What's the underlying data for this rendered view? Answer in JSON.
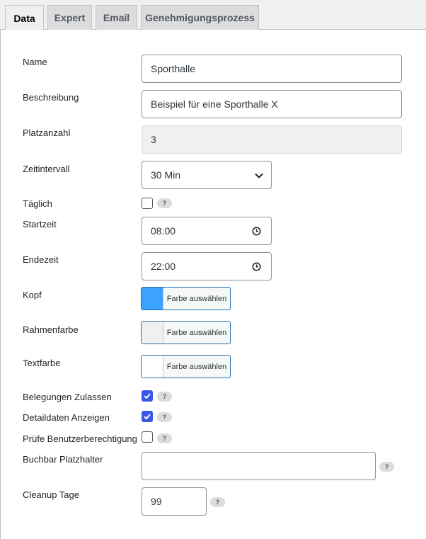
{
  "tabs": [
    {
      "label": "Data",
      "active": true
    },
    {
      "label": "Expert"
    },
    {
      "label": "Email"
    },
    {
      "label": "Genehmigungsprozess"
    }
  ],
  "form": {
    "name": {
      "label": "Name",
      "value": "Sporthalle"
    },
    "beschreibung": {
      "label": "Beschreibung",
      "value": "Beispiel für eine Sporthalle X"
    },
    "platzanzahl": {
      "label": "Platzanzahl",
      "value": "3"
    },
    "zeitintervall": {
      "label": "Zeitintervall",
      "value": "30 Min"
    },
    "taeglich": {
      "label": "Täglich",
      "checked": false
    },
    "startzeit": {
      "label": "Startzeit",
      "value": "08:00"
    },
    "endezeit": {
      "label": "Endezeit",
      "value": "22:00"
    },
    "kopf": {
      "label": "Kopf",
      "button_label": "Farbe auswählen",
      "color": "#3ba2ff"
    },
    "rahmenfarbe": {
      "label": "Rahmenfarbe",
      "button_label": "Farbe auswählen",
      "color": "#f0f0f1"
    },
    "textfarbe": {
      "label": "Textfarbe",
      "button_label": "Farbe auswählen",
      "color": "#ffffff"
    },
    "belegungen": {
      "label": "Belegungen Zulassen",
      "checked": true
    },
    "detaildaten": {
      "label": "Detaildaten Anzeigen",
      "checked": true
    },
    "pruefe": {
      "label": "Prüfe Benutzerberechtigung",
      "checked": false
    },
    "buchbar": {
      "label": "Buchbar Platzhalter",
      "value": ""
    },
    "cleanup": {
      "label": "Cleanup Tage",
      "value": "99"
    }
  },
  "help_text": "?",
  "icons": {
    "chevron": "chevron-down-icon",
    "clock": "clock-icon",
    "check": "checkmark-icon"
  },
  "colors": {
    "accent": "#3858e9",
    "button_border": "#2271b1"
  }
}
